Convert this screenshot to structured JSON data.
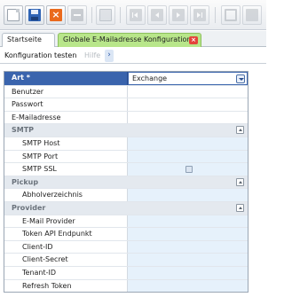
{
  "tabs": {
    "start": "Startseite",
    "active": "Globale E-Mailadresse Konfiguration",
    "close_glyph": "×"
  },
  "subbar": {
    "test_label": "Konfiguration testen",
    "help_label": "Hilfe",
    "chevron": "›"
  },
  "toolbar": {
    "delete_glyph": "×"
  },
  "grid": {
    "art_label": "Art *",
    "art_value": "Exchange",
    "fields_top": [
      "Benutzer",
      "Passwort",
      "E-Mailadresse"
    ],
    "smtp_header": "SMTP",
    "smtp_fields": [
      "SMTP Host",
      "SMTP Port",
      "SMTP SSL"
    ],
    "pickup_header": "Pickup",
    "pickup_fields": [
      "Abholverzeichnis"
    ],
    "provider_header": "Provider",
    "provider_fields": [
      "E-Mail Provider",
      "Token API Endpunkt",
      "Client-ID",
      "Client-Secret",
      "Tenant-ID",
      "Refresh Token"
    ]
  }
}
